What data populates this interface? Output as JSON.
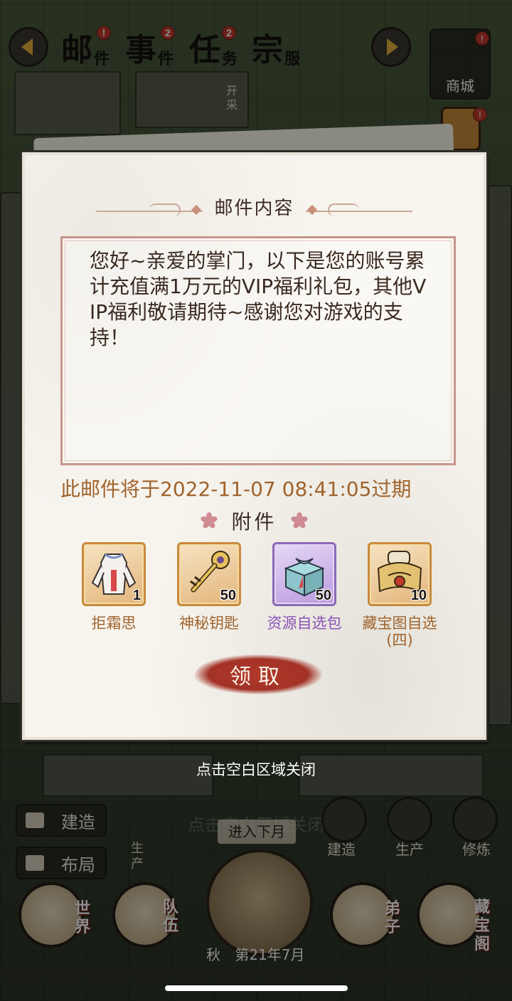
{
  "top_tabs": [
    {
      "big": "邮",
      "small": "件",
      "badge": "!"
    },
    {
      "big": "事",
      "small": "件",
      "badge": "2"
    },
    {
      "big": "任",
      "small": "务",
      "badge": "2"
    },
    {
      "big": "宗",
      "small": "服",
      "badge": ""
    }
  ],
  "side": {
    "shop_label": "商城",
    "shop_badge": "!",
    "bag_badge": "!",
    "open_mine": "开采"
  },
  "modal": {
    "title": "邮件内容",
    "message": "您好~亲爱的掌门，以下是您的账号累计充值满1万元的VIP福利礼包，其他VIP福利敬请期待~感谢您对游戏的支持！",
    "expire_text": "此邮件将于2022-11-07 08:41:05过期",
    "attachments_title": "附件",
    "attachments": [
      {
        "name": "拒霜思",
        "count": "1",
        "icon": "white-robe-icon",
        "rarity": "orange"
      },
      {
        "name": "神秘钥匙",
        "count": "50",
        "icon": "golden-key-icon",
        "rarity": "orange"
      },
      {
        "name": "资源自选包",
        "count": "50",
        "icon": "gift-box-icon",
        "rarity": "purple"
      },
      {
        "name": "藏宝图自选(四)",
        "count": "10",
        "icon": "treasure-map-icon",
        "rarity": "orange"
      }
    ],
    "claim_label": "领取"
  },
  "close_hint": "点击空白区域关闭",
  "background_hud": {
    "ghost_hint": "点击空白区域关闭",
    "build_label": "建造",
    "layout_label": "布局",
    "produce_side": "生产",
    "next_month": "进入下月",
    "round_build": "建造",
    "round_produce": "生产",
    "round_cultivate": "修炼",
    "nav_world": "世界",
    "nav_team": "队伍",
    "nav_disciple": "弟子",
    "nav_treasure": "藏宝阁",
    "season": "秋",
    "year_month": "第21年7月"
  },
  "colors": {
    "expire_text": "#a0632c",
    "item_name_orange": "#a0632c",
    "item_name_purple": "#8a52b8",
    "claim_button": "#a33226",
    "message_border": "#c7968c"
  }
}
